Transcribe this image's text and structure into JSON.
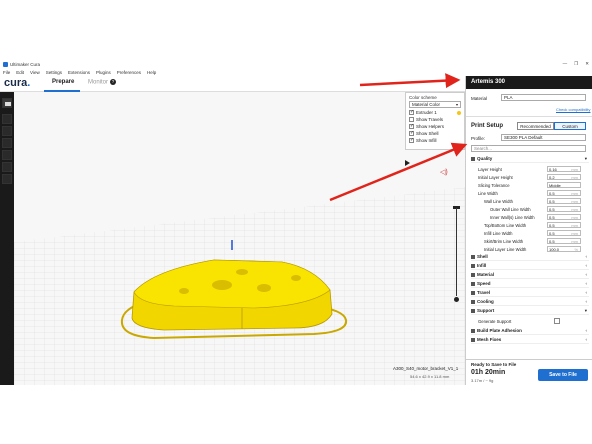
{
  "window": {
    "title": "Ultimaker Cura",
    "controls": [
      "—",
      "❐",
      "✕"
    ]
  },
  "menu": [
    "File",
    "Edit",
    "View",
    "Settings",
    "Extensions",
    "Plugins",
    "Preferences",
    "Help"
  ],
  "header": {
    "logo": "cura",
    "logo_dot": ".",
    "tab_prepare": "Prepare",
    "tab_monitor": "Monitor"
  },
  "color_scheme": {
    "title": "Color scheme",
    "value": "Material Color",
    "options": [
      {
        "label": "Extruder 1",
        "checked": true
      },
      {
        "label": "Show Travels",
        "checked": false
      },
      {
        "label": "Show Helpers",
        "checked": true
      },
      {
        "label": "Show Shell",
        "checked": true
      },
      {
        "label": "Show Infill",
        "checked": true
      }
    ]
  },
  "model": {
    "filename": "A300_S40_motor_bracket_V1_1",
    "dimensions": "54.6 x 42.9 x 11.8 mm"
  },
  "printer": {
    "name": "Artemis 300"
  },
  "material": {
    "label": "Material",
    "value": "PLA",
    "check_link": "Check compatibility"
  },
  "print_setup": {
    "title": "Print Setup",
    "recommended": "Recommended",
    "custom": "Custom",
    "profile_label": "Profile:",
    "profile_value": "SE300 PLA Default",
    "search_placeholder": "Search..."
  },
  "quality": {
    "title": "Quality",
    "settings": [
      {
        "label": "Layer Height",
        "value": "0.16",
        "unit": "mm"
      },
      {
        "label": "Initial Layer Height",
        "value": "0.2",
        "unit": "mm"
      },
      {
        "label": "Slicing Tolerance",
        "value": "Middle",
        "unit": ""
      },
      {
        "label": "Line Width",
        "value": "0.5",
        "unit": "mm"
      },
      {
        "label": "Wall Line Width",
        "value": "0.5",
        "unit": "mm"
      },
      {
        "label": "Outer Wall Line Width",
        "value": "0.5",
        "unit": "mm"
      },
      {
        "label": "Inner Wall(s) Line Width",
        "value": "0.5",
        "unit": "mm"
      },
      {
        "label": "Top/Bottom Line Width",
        "value": "0.5",
        "unit": "mm"
      },
      {
        "label": "Infill Line Width",
        "value": "0.5",
        "unit": "mm"
      },
      {
        "label": "Skirt/Brim Line Width",
        "value": "0.5",
        "unit": "mm"
      },
      {
        "label": "Initial Layer Line Width",
        "value": "100.0",
        "unit": "%"
      }
    ]
  },
  "sections": [
    "Shell",
    "Infill",
    "Material",
    "Speed",
    "Travel",
    "Cooling",
    "Support"
  ],
  "support_setting": {
    "label": "Generate Support"
  },
  "sections2": [
    "Build Plate Adhesion",
    "Mesh Fixes"
  ],
  "footer": {
    "ready": "Ready to Save to File",
    "time": "01h 20min",
    "material_use": "3.17m / ~ 9g",
    "save": "Save to File"
  },
  "colors": {
    "accent": "#1f6fd1",
    "model": "#f5e000",
    "arrow": "#e0241b"
  }
}
